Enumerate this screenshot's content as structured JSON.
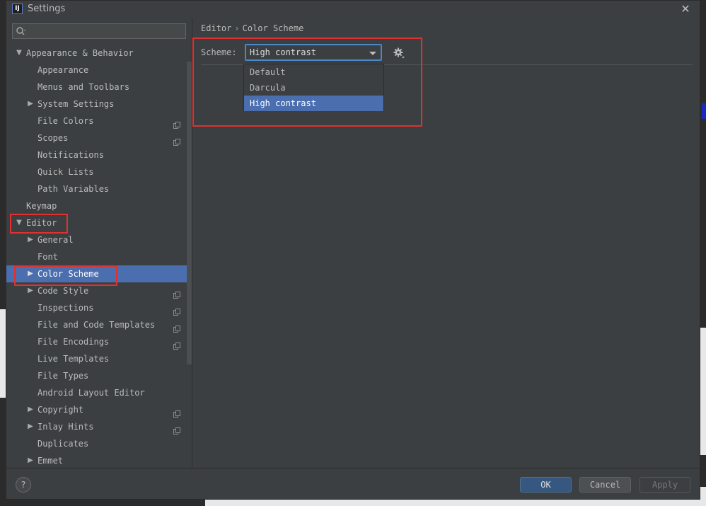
{
  "window": {
    "title": "Settings",
    "app_icon_text": "IJ"
  },
  "search": {
    "placeholder": "",
    "value": ""
  },
  "tree": [
    {
      "label": "Appearance & Behavior",
      "indent": 0,
      "arrow": "down",
      "copy": false,
      "selected": false
    },
    {
      "label": "Appearance",
      "indent": 1,
      "arrow": "",
      "copy": false,
      "selected": false
    },
    {
      "label": "Menus and Toolbars",
      "indent": 1,
      "arrow": "",
      "copy": false,
      "selected": false
    },
    {
      "label": "System Settings",
      "indent": 1,
      "arrow": "right",
      "copy": false,
      "selected": false
    },
    {
      "label": "File Colors",
      "indent": 1,
      "arrow": "",
      "copy": true,
      "selected": false
    },
    {
      "label": "Scopes",
      "indent": 1,
      "arrow": "",
      "copy": true,
      "selected": false
    },
    {
      "label": "Notifications",
      "indent": 1,
      "arrow": "",
      "copy": false,
      "selected": false
    },
    {
      "label": "Quick Lists",
      "indent": 1,
      "arrow": "",
      "copy": false,
      "selected": false
    },
    {
      "label": "Path Variables",
      "indent": 1,
      "arrow": "",
      "copy": false,
      "selected": false
    },
    {
      "label": "Keymap",
      "indent": 0,
      "arrow": "",
      "copy": false,
      "selected": false
    },
    {
      "label": "Editor",
      "indent": 0,
      "arrow": "down",
      "copy": false,
      "selected": false
    },
    {
      "label": "General",
      "indent": 1,
      "arrow": "right",
      "copy": false,
      "selected": false
    },
    {
      "label": "Font",
      "indent": 1,
      "arrow": "",
      "copy": false,
      "selected": false
    },
    {
      "label": "Color Scheme",
      "indent": 1,
      "arrow": "right",
      "copy": false,
      "selected": true
    },
    {
      "label": "Code Style",
      "indent": 1,
      "arrow": "right",
      "copy": true,
      "selected": false
    },
    {
      "label": "Inspections",
      "indent": 1,
      "arrow": "",
      "copy": true,
      "selected": false
    },
    {
      "label": "File and Code Templates",
      "indent": 1,
      "arrow": "",
      "copy": true,
      "selected": false
    },
    {
      "label": "File Encodings",
      "indent": 1,
      "arrow": "",
      "copy": true,
      "selected": false
    },
    {
      "label": "Live Templates",
      "indent": 1,
      "arrow": "",
      "copy": false,
      "selected": false
    },
    {
      "label": "File Types",
      "indent": 1,
      "arrow": "",
      "copy": false,
      "selected": false
    },
    {
      "label": "Android Layout Editor",
      "indent": 1,
      "arrow": "",
      "copy": false,
      "selected": false
    },
    {
      "label": "Copyright",
      "indent": 1,
      "arrow": "right",
      "copy": true,
      "selected": false
    },
    {
      "label": "Inlay Hints",
      "indent": 1,
      "arrow": "right",
      "copy": true,
      "selected": false
    },
    {
      "label": "Duplicates",
      "indent": 1,
      "arrow": "",
      "copy": false,
      "selected": false
    },
    {
      "label": "Emmet",
      "indent": 1,
      "arrow": "right",
      "copy": false,
      "selected": false
    }
  ],
  "breadcrumb": {
    "parent": "Editor",
    "separator": "›",
    "current": "Color Scheme"
  },
  "scheme": {
    "label": "Scheme:",
    "selected": "High contrast",
    "options": [
      {
        "label": "Default",
        "selected": false
      },
      {
        "label": "Darcula",
        "selected": false
      },
      {
        "label": "High contrast",
        "selected": true
      }
    ]
  },
  "buttons": {
    "help": "?",
    "ok": "OK",
    "cancel": "Cancel",
    "apply": "Apply"
  },
  "colors": {
    "accent_selection": "#4b6eaf",
    "annotation_red": "#e0312e",
    "background": "#3c3f41"
  },
  "icons": {
    "close": "close-icon",
    "search": "search-icon",
    "gear": "gear-icon",
    "copy": "copy-icon",
    "help": "help-icon"
  }
}
